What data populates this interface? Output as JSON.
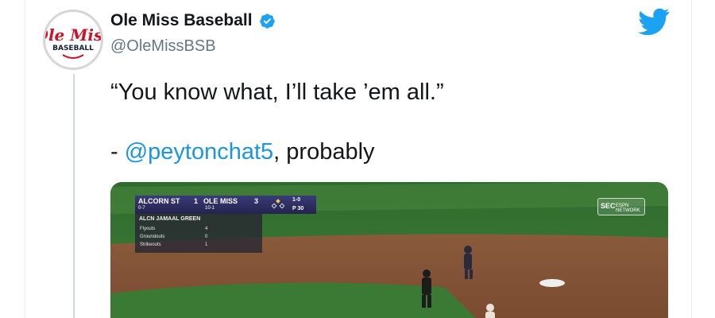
{
  "account": {
    "name": "Ole Miss Baseball",
    "handle": "@OleMissBSB",
    "logo_text_top": "Ole Miss",
    "logo_text_bottom": "BASEBALL"
  },
  "tweet": {
    "line1": "“You know what, I’ll take ’em all.”",
    "line2_prefix": "- ",
    "mention": "@peytonchat5",
    "line2_suffix": ", probably"
  },
  "scorebug": {
    "team1": "ALCORN ST",
    "score1": "1",
    "record1": "0-7",
    "team2": "OLE MISS",
    "score2": "3",
    "record2": "10-1",
    "count": "1-0",
    "pitch_count": "P 30",
    "player": "ALCN JAMAAL GREEN",
    "stats": [
      {
        "label": "Flyouts",
        "value": "4"
      },
      {
        "label": "Groundouts",
        "value": "0"
      },
      {
        "label": "Strikeouts",
        "value": "1"
      }
    ]
  },
  "network": {
    "sec": "SEC",
    "label": "ESPN NETWORK"
  },
  "colors": {
    "link": "#1b95e0",
    "twitter": "#1da1f2",
    "ole_miss_red": "#ce1126",
    "navy": "#14213d"
  },
  "icons": {
    "verified": "verified-badge-icon",
    "twitter": "twitter-bird-icon"
  }
}
